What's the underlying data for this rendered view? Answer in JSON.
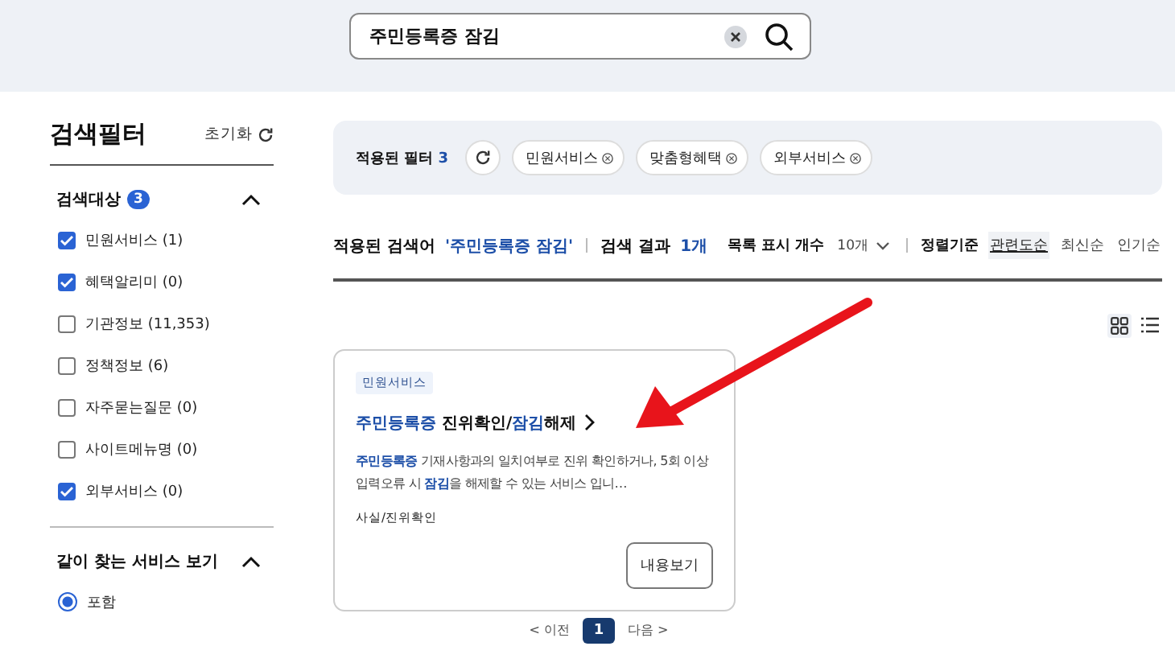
{
  "search": {
    "value": "주민등록증 잠김"
  },
  "sidebar": {
    "title": "검색필터",
    "reset": "초기화",
    "sections": [
      {
        "title": "검색대상",
        "count": "3",
        "expanded": true,
        "kind": "checkbox",
        "options": [
          {
            "label": "민원서비스 (1)",
            "checked": true
          },
          {
            "label": "혜택알리미 (0)",
            "checked": true
          },
          {
            "label": "기관정보 (11,353)",
            "checked": false
          },
          {
            "label": "정책정보 (6)",
            "checked": false
          },
          {
            "label": "자주묻는질문 (0)",
            "checked": false
          },
          {
            "label": "사이트메뉴명 (0)",
            "checked": false
          },
          {
            "label": "외부서비스 (0)",
            "checked": true
          }
        ]
      },
      {
        "title": "같이 찾는 서비스 보기",
        "expanded": true,
        "kind": "radio",
        "options": [
          {
            "label": "포함",
            "checked": true
          }
        ]
      }
    ]
  },
  "applied_filters": {
    "label": "적용된 필터",
    "count": "3",
    "chips": [
      "민원서비스",
      "맞춤형혜택",
      "외부서비스"
    ]
  },
  "summary": {
    "query_label": "적용된 검색어",
    "query": "'주민등록증 잠김'",
    "result_label": "검색 결과",
    "result_count": "1개"
  },
  "list_controls": {
    "page_size_label": "목록 표시 개수",
    "page_size": "10개",
    "sort_label": "정렬기준",
    "sort_options": [
      {
        "label": "관련도순",
        "selected": true
      },
      {
        "label": "최신순",
        "selected": false
      },
      {
        "label": "인기순",
        "selected": false
      }
    ],
    "views": [
      {
        "kind": "grid",
        "selected": true
      },
      {
        "kind": "list",
        "selected": false
      }
    ]
  },
  "results": [
    {
      "tag": "민원서비스",
      "title": "**주민등록증** 진위확인/**잠김**해제",
      "description": "**주민등록증** 기재사항과의 일치여부로 진위 확인하거나, 5회 이상 입력오류 시 **잠김**을 해제할 수 있는 서비스 입니…",
      "category": "사실/진위확인",
      "button": "내용보기"
    }
  ],
  "pagination": {
    "prev": "< 이전",
    "pages": [
      {
        "label": "1",
        "selected": true
      }
    ],
    "next": "다음 >"
  }
}
